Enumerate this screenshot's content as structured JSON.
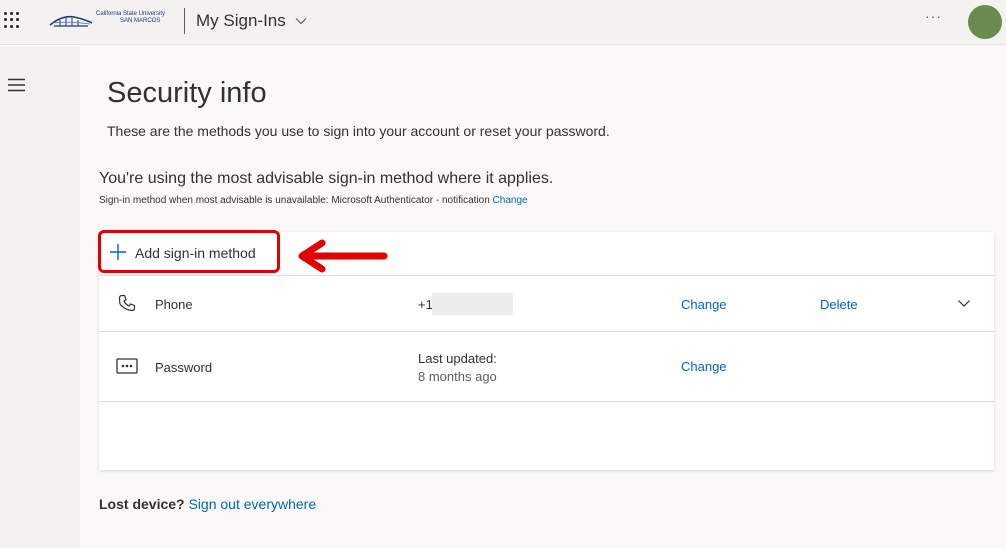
{
  "header": {
    "logo_line1": "California State University",
    "logo_line2": "SAN MARCOS",
    "app_title": "My Sign-Ins",
    "more_label": "···"
  },
  "page": {
    "title": "Security info",
    "description": "These are the methods you use to sign into your account or reset your password.",
    "advisable_heading": "You're using the most advisable sign-in method where it applies.",
    "advisable_sub": "Sign-in method when most advisable is unavailable: Microsoft Authenticator - notification",
    "advisable_change": "Change"
  },
  "card": {
    "add_method_label": "Add sign-in method",
    "methods": [
      {
        "name": "Phone",
        "value": "+1",
        "change_label": "Change",
        "delete_label": "Delete"
      },
      {
        "name": "Password",
        "value_line1": "Last updated:",
        "value_line2": "8 months ago",
        "change_label": "Change"
      }
    ]
  },
  "footer": {
    "lost_device": "Lost device?",
    "sign_out_everywhere": "Sign out everywhere"
  },
  "colors": {
    "accent": "#0067b8",
    "annotation_red": "#e00000",
    "avatar": "#6a8a4f"
  }
}
